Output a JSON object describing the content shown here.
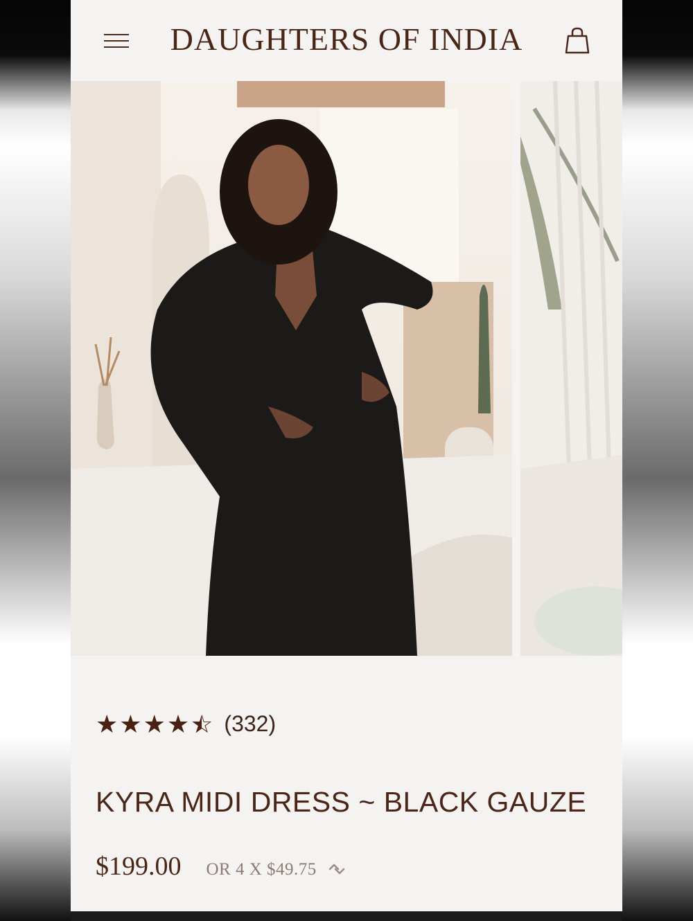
{
  "header": {
    "brand": "DAUGHTERS OF INDIA",
    "menu_icon": "hamburger-menu-icon",
    "cart_icon": "shopping-bag-icon"
  },
  "gallery": {
    "slides": [
      "product-photo-1",
      "product-photo-2"
    ]
  },
  "product": {
    "rating_value": 4.5,
    "rating_max": 5,
    "review_count": "(332)",
    "title": "KYRA MIDI DRESS ~ BLACK GAUZE",
    "price": "$199.00",
    "installments": "OR 4 X $49.75",
    "installments_icon": "afterpay-cycle-icon"
  },
  "colors": {
    "brand_brown": "#4a2618",
    "background": "#f5f3f1",
    "muted_text": "#8a7a72"
  }
}
